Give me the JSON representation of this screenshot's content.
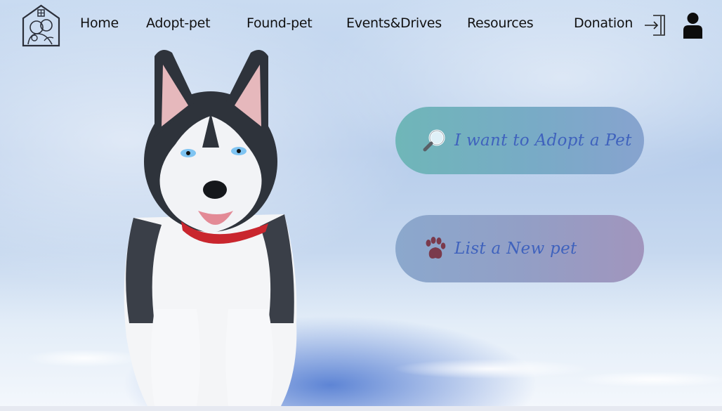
{
  "nav": {
    "logo": "pet-shelter-logo",
    "links": [
      {
        "label": "Home"
      },
      {
        "label": "Adopt-pet"
      },
      {
        "label": "Found-pet"
      },
      {
        "label": "Events&Drives"
      },
      {
        "label": "Resources"
      },
      {
        "label": "Donation"
      }
    ],
    "icons": {
      "login": "login-icon",
      "user": "user-icon"
    }
  },
  "hero": {
    "image": "husky-puppy-in-snow",
    "actions": [
      {
        "label": "I want to Adopt a Pet",
        "icon": "magnifier-icon"
      },
      {
        "label": "List a New pet",
        "icon": "paw-icon"
      }
    ]
  },
  "colors": {
    "adopt_button": "#78abc6",
    "list_button": "#929fc6",
    "button_text": "#3f62bd",
    "paw": "#7a3a4c"
  }
}
